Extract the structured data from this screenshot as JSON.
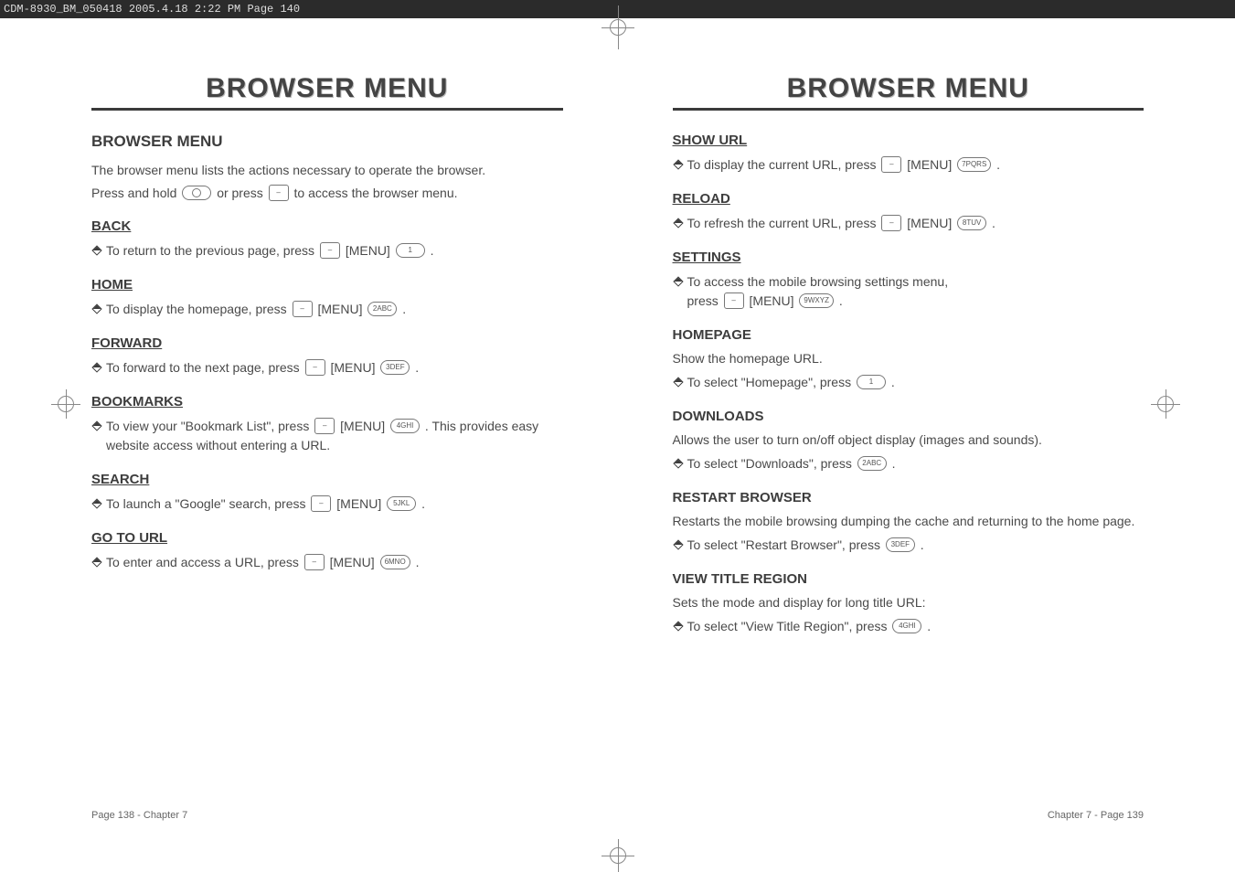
{
  "meta": {
    "imposition": "CDM-8930_BM_050418  2005.4.18  2:22 PM  Page 140"
  },
  "left": {
    "title": "BROWSER MENU",
    "section": "BROWSER MENU",
    "intro1": "The browser menu lists the actions necessary to operate the browser.",
    "intro2_a": "Press and hold ",
    "intro2_b": " or press ",
    "intro2_c": " to access the browser menu.",
    "back": {
      "h": "BACK",
      "t_a": "To return to the previous page, press ",
      "t_b": " [MENU] ",
      "t_c": " ."
    },
    "home": {
      "h": "HOME",
      "t_a": "To display the homepage, press ",
      "t_b": " [MENU] ",
      "t_c": " ."
    },
    "forward": {
      "h": "FORWARD",
      "t_a": "To forward to the next page, press ",
      "t_b": " [MENU] ",
      "t_c": " ."
    },
    "bookmarks": {
      "h": "BOOKMARKS",
      "t_a": "To view your \"Bookmark List\", press ",
      "t_b": " [MENU] ",
      "t_c": " . This provides easy website access without entering a URL."
    },
    "search": {
      "h": "SEARCH",
      "t_a": "To launch a \"Google\" search, press ",
      "t_b": " [MENU] ",
      "t_c": " ."
    },
    "gotourl": {
      "h": "GO TO URL",
      "t_a": "To enter and access a URL, press ",
      "t_b": " [MENU] ",
      "t_c": " ."
    },
    "footer": "Page 138 - Chapter 7",
    "keys": {
      "ok": "",
      "soft": "–",
      "k1": "1",
      "k2": "2ABC",
      "k3": "3DEF",
      "k4": "4GHI",
      "k5": "5JKL",
      "k6": "6MNO"
    }
  },
  "right": {
    "title": "BROWSER MENU",
    "showurl": {
      "h": "SHOW URL",
      "t_a": "To display the current URL, press ",
      "t_b": " [MENU] ",
      "t_c": " ."
    },
    "reload": {
      "h": "RELOAD",
      "t_a": "To refresh the current URL, press ",
      "t_b": " [MENU] ",
      "t_c": " ."
    },
    "settings": {
      "h": "SETTINGS",
      "t_a": "To access the mobile browsing settings menu,",
      "t_b": "press ",
      "t_c": " [MENU] ",
      "t_d": " ."
    },
    "homepage": {
      "h": "HOMEPAGE",
      "d": "Show the homepage URL.",
      "t_a": "To select \"Homepage\", press ",
      "t_b": " ."
    },
    "downloads": {
      "h": "DOWNLOADS",
      "d": "Allows the user to turn on/off object display (images and sounds).",
      "t_a": "To select \"Downloads\", press ",
      "t_b": " ."
    },
    "restart": {
      "h": "RESTART BROWSER",
      "d": "Restarts the mobile browsing dumping the cache and returning to the home page.",
      "t_a": "To select \"Restart Browser\", press ",
      "t_b": " ."
    },
    "viewtitle": {
      "h": "VIEW TITLE REGION",
      "d": "Sets the mode and display for long title URL:",
      "t_a": "To select \"View Title Region\", press ",
      "t_b": " ."
    },
    "footer": "Chapter 7 - Page 139",
    "keys": {
      "soft": "–",
      "k7": "7PQRS",
      "k8": "8TUV",
      "k9": "9WXYZ",
      "k1": "1",
      "k2": "2ABC",
      "k3": "3DEF",
      "k4": "4GHI"
    }
  }
}
